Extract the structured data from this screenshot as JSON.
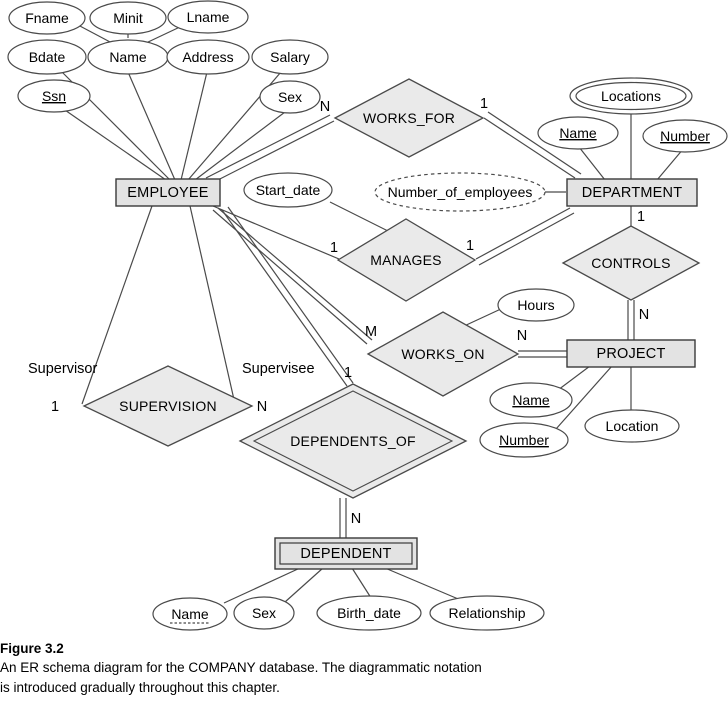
{
  "figure": {
    "caption_title": "Figure 3.2",
    "caption_line1": "An ER schema diagram for the COMPANY database. The diagrammatic notation",
    "caption_line2": "is introduced gradually throughout this chapter."
  },
  "colors": {
    "entity_fill": "#e3e3e3",
    "relationship_fill": "#eaeaea",
    "attribute_fill": "#ffffff",
    "stroke": "#4a4a4a",
    "background": "#ffffff"
  },
  "entities": [
    {
      "id": "employee",
      "label": "EMPLOYEE",
      "kind": "strong"
    },
    {
      "id": "department",
      "label": "DEPARTMENT",
      "kind": "strong"
    },
    {
      "id": "project",
      "label": "PROJECT",
      "kind": "strong"
    },
    {
      "id": "dependent",
      "label": "DEPENDENT",
      "kind": "weak"
    }
  ],
  "relationships": [
    {
      "id": "works_for",
      "label": "WORKS_FOR",
      "kind": "normal",
      "participants": [
        "EMPLOYEE",
        "DEPARTMENT"
      ],
      "cardinality": "N:1"
    },
    {
      "id": "manages",
      "label": "MANAGES",
      "kind": "normal",
      "participants": [
        "EMPLOYEE",
        "DEPARTMENT"
      ],
      "cardinality": "1:1"
    },
    {
      "id": "controls",
      "label": "CONTROLS",
      "kind": "normal",
      "participants": [
        "DEPARTMENT",
        "PROJECT"
      ],
      "cardinality": "1:N"
    },
    {
      "id": "works_on",
      "label": "WORKS_ON",
      "kind": "normal",
      "participants": [
        "EMPLOYEE",
        "PROJECT"
      ],
      "cardinality": "M:N"
    },
    {
      "id": "supervision",
      "label": "SUPERVISION",
      "kind": "normal",
      "participants": [
        "EMPLOYEE",
        "EMPLOYEE"
      ],
      "cardinality": "1:N"
    },
    {
      "id": "dependents_of",
      "label": "DEPENDENTS_OF",
      "kind": "identifying",
      "participants": [
        "EMPLOYEE",
        "DEPENDENT"
      ],
      "cardinality": "1:N"
    }
  ],
  "attributes": {
    "employee": [
      {
        "label": "Fname",
        "kind": "simple"
      },
      {
        "label": "Minit",
        "kind": "simple"
      },
      {
        "label": "Lname",
        "kind": "simple"
      },
      {
        "label": "Name",
        "kind": "composite"
      },
      {
        "label": "Bdate",
        "kind": "simple"
      },
      {
        "label": "Address",
        "kind": "simple"
      },
      {
        "label": "Salary",
        "kind": "simple"
      },
      {
        "label": "Sex",
        "kind": "simple"
      },
      {
        "label": "Ssn",
        "kind": "key"
      }
    ],
    "department": [
      {
        "label": "Name",
        "kind": "key"
      },
      {
        "label": "Number",
        "kind": "key"
      },
      {
        "label": "Locations",
        "kind": "multivalued"
      },
      {
        "label": "Number_of_employees",
        "kind": "derived"
      }
    ],
    "project": [
      {
        "label": "Name",
        "kind": "key"
      },
      {
        "label": "Number",
        "kind": "key"
      },
      {
        "label": "Location",
        "kind": "simple"
      }
    ],
    "dependent": [
      {
        "label": "Name",
        "kind": "partial-key"
      },
      {
        "label": "Sex",
        "kind": "simple"
      },
      {
        "label": "Birth_date",
        "kind": "simple"
      },
      {
        "label": "Relationship",
        "kind": "simple"
      }
    ],
    "manages": [
      {
        "label": "Start_date",
        "kind": "simple"
      }
    ],
    "works_on": [
      {
        "label": "Hours",
        "kind": "simple"
      }
    ]
  },
  "cardinality_labels": {
    "works_for_employee": "N",
    "works_for_department": "1",
    "manages_employee": "1",
    "manages_department": "1",
    "controls_department": "1",
    "controls_project": "N",
    "works_on_employee": "M",
    "works_on_project": "N",
    "supervision_supervisor": "1",
    "supervision_supervisee": "N",
    "dependents_of_employee": "1",
    "dependents_of_dependent": "N"
  },
  "role_labels": {
    "supervisor": "Supervisor",
    "supervisee": "Supervisee"
  }
}
